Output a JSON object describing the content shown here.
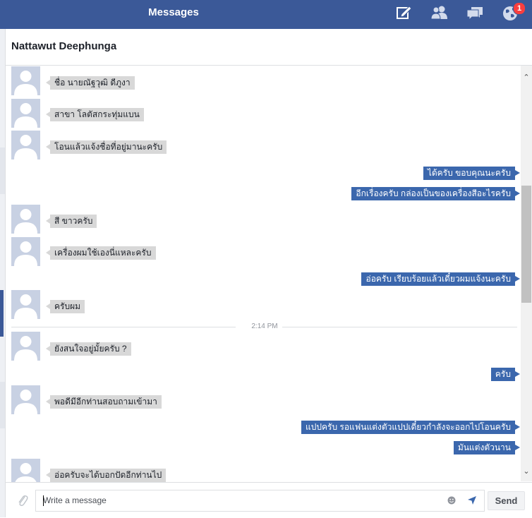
{
  "topbar": {
    "title": "Messages",
    "icons": [
      "compose-icon",
      "friend-requests-icon",
      "messages-icon",
      "notifications-globe-icon"
    ],
    "notification_count": "1",
    "color": "#3b5998"
  },
  "conversation": {
    "contact_name": "Nattawut Deephunga"
  },
  "messages": [
    {
      "dir": "in",
      "text": "ชื่อ นายณัฐวุฒิ ดีภูงา"
    },
    {
      "dir": "in",
      "text": "สาขา โลตัสกระทุ่มแบน"
    },
    {
      "dir": "in",
      "text": "โอนแล้วแจ้งชื่อที่อยู่มานะครับ"
    },
    {
      "dir": "out",
      "text": "ได้ครับ ขอบคุณนะครับ"
    },
    {
      "dir": "out",
      "text": "อีกเรื่องครับ กล่องเป็นของเครื่องสีอะไรครับ"
    },
    {
      "dir": "in",
      "text": "สี ขาวครับ"
    },
    {
      "dir": "in",
      "text": "เครื่องผมใช้เองนี่แหละครับ"
    },
    {
      "dir": "out",
      "text": "อ่อครับ เรียบร้อยแล้วเดี๋ยวผมแจ้งนะครับ"
    },
    {
      "dir": "in",
      "text": "ครับผม"
    },
    {
      "dir": "in",
      "text": "ยังสนใจอยู่มั้ยครับ ?"
    },
    {
      "dir": "out",
      "text": "ครับ"
    },
    {
      "dir": "in",
      "text": "พอดีมีอีกท่านสอบถามเข้ามา"
    },
    {
      "dir": "out",
      "text": "แปปครับ รอแฟนแต่งตัวแปปเดี๋ยวกำลังจะออกไปโอนครับ"
    },
    {
      "dir": "out",
      "text": "มันแต่งตัวนาน"
    },
    {
      "dir": "in",
      "text": "อ่อครับจะได้บอกปัดอีกท่านไป"
    }
  ],
  "timestamp_divider": "2:14 PM",
  "composer": {
    "placeholder": "Write a message",
    "send_label": "Send"
  },
  "colors": {
    "outgoing_bubble": "#3b67ad",
    "incoming_bubble": "#d8d8d8",
    "badge": "#fa3e3e"
  }
}
